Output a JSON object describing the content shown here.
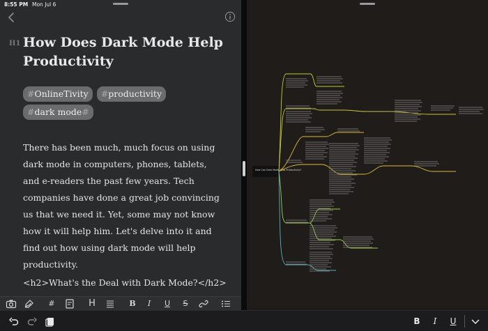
{
  "status_bar": {
    "time": "8:55 PM",
    "date": "Mon Jul 6"
  },
  "editor": {
    "heading_marker": "H1",
    "title": "How Does Dark Mode Help Productivity",
    "tags": [
      {
        "hash": "#",
        "text": "OnlineTivity",
        "suffix": ""
      },
      {
        "hash": "#",
        "text": "productivity",
        "suffix": ""
      },
      {
        "hash": "#",
        "text": "dark mode",
        "suffix": "#"
      }
    ],
    "paragraph": "There has been much, much focus on using dark mode in computers, phones, tablets, and e-readers the past few years. Tech companies have done a great job convincing us that we need it. Yet, some may not know how it will help him. Let's delve into it and find out how using dark mode will help productivity.",
    "h2_raw": "<h2>What's the Deal with Dark Mode?</h2>"
  },
  "format_bar": {
    "heading": "H",
    "bold": "B",
    "italic": "I",
    "underline": "U",
    "strike": "S",
    "hash": "#"
  },
  "bottom_bar": {
    "bold": "B",
    "italic": "I",
    "underline": "U"
  },
  "mindmap": {
    "root": "How Can Dark Mode Help Productivity?",
    "colors": {
      "branch_a": "#b7d433",
      "branch_b": "#c9c43c",
      "branch_c": "#e0b93a",
      "branch_d": "#9bd04a",
      "branch_e": "#5ab0c8"
    }
  },
  "colors": {
    "editor_bg": "#2a2b2d",
    "tag_bg": "#6b6c6e",
    "map_bg": "#201c1a"
  }
}
